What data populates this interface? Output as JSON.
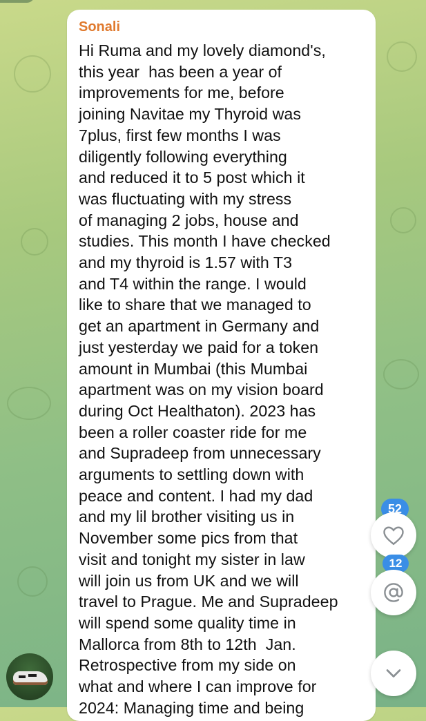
{
  "message": {
    "sender": "Sonali",
    "lines": [
      "Hi Ruma and my lovely diamond's,",
      "this year  has been a year of",
      "improvements for me, before",
      "joining Navitae my Thyroid was",
      "7plus, first few months I was",
      "diligently following everything",
      "and reduced it to 5 post which it",
      "was fluctuating with my stress",
      "of managing 2 jobs, house and",
      "studies. This month I have checked",
      "and my thyroid is 1.57 with T3",
      "and T4 within the range. I would",
      "like to share that we managed to",
      "get an apartment in Germany and",
      "just yesterday we paid for a token",
      "amount in Mumbai (this Mumbai",
      "apartment was on my vision board",
      "during Oct Healthaton). 2023 has",
      "been a roller coaster ride for me",
      "and Supradeep from unnecessary",
      "arguments to settling down with",
      "peace and content. I had my dad",
      "and my lil brother visiting us in",
      "November some pics from that",
      "visit and tonight my sister in law",
      "will join us from UK and we will",
      "travel to Prague. Me and Supradeep",
      "will spend some quality time in",
      "Mallorca from 8th to 12th  Jan.",
      "Retrospective from my side on",
      "what and where I can improve for",
      "2024: Managing time and being"
    ]
  },
  "badges": {
    "reactions_count": "52",
    "mentions_count": "12"
  },
  "icons": {
    "heart": "heart-icon",
    "mention": "at-sign-icon",
    "scroll_down": "chevron-down-icon"
  },
  "colors": {
    "sender_name": "#e07a2e",
    "badge": "#3a8ee6",
    "bubble": "#ffffff"
  }
}
